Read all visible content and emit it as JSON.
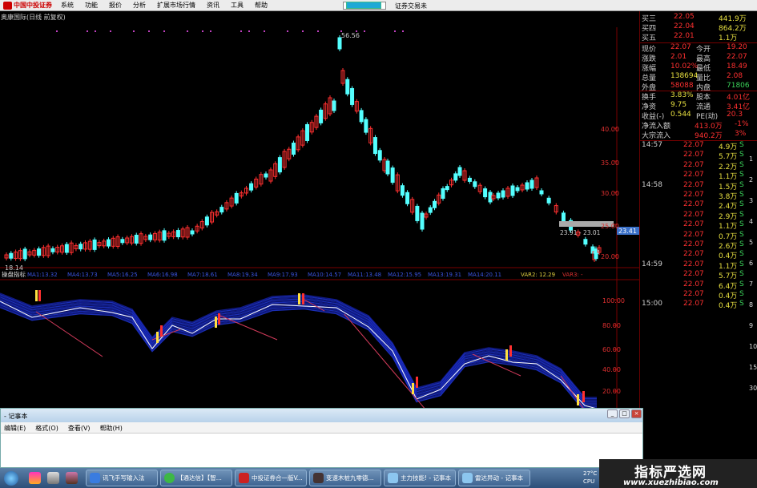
{
  "menubar": {
    "brand": "中国中投证券",
    "items": [
      "系统",
      "功能",
      "报价",
      "分析",
      "扩展市场行情",
      "资讯",
      "工具",
      "帮助"
    ],
    "trade_link": "证券交易未"
  },
  "chart": {
    "title": "奥康国际(日线 前复权)",
    "price_axis": [
      "40.00",
      "35.00",
      "30.00",
      "25.00",
      "20.00"
    ],
    "high_label": "56.56",
    "low_label": "18.14",
    "crosshair_label": "23.41",
    "crosshair_values": "23.91 - 23.01",
    "indicator_name": "操盘指标",
    "indicator_vars": [
      "MA1:13.32",
      "MA4:13.73",
      "MA5:16.25",
      "MA6:16.98",
      "MA7:18.61",
      "MA8:19.34",
      "MA9:17.93",
      "MA10:14.57",
      "MA11:13.48",
      "MA12:15.95",
      "MA13:19.31",
      "MA14:20.11"
    ],
    "var2": "VAR2: 12.29",
    "var3": "VAR3: -",
    "indicator_axis": [
      "100.00",
      "80.00",
      "60.00",
      "40.00",
      "20.00"
    ]
  },
  "quote": {
    "orders": [
      {
        "label": "买三",
        "price": "22.05",
        "vol": "441.9万"
      },
      {
        "label": "买四",
        "price": "22.04",
        "vol": "864.2万"
      },
      {
        "label": "买五",
        "price": "22.01",
        "vol": "1.1万"
      }
    ],
    "stats": [
      {
        "l1": "现价",
        "v1": "22.07",
        "l2": "今开",
        "v2": "19.20"
      },
      {
        "l1": "涨跌",
        "v1": "2.01",
        "l2": "最高",
        "v2": "22.07"
      },
      {
        "l1": "涨幅",
        "v1": "10.02%",
        "l2": "最低",
        "v2": "18.49"
      },
      {
        "l1": "总量",
        "v1": "138694",
        "l2": "量比",
        "v2": "2.08"
      },
      {
        "l1": "外盘",
        "v1": "58088",
        "l2": "内盘",
        "v2": "71806"
      },
      {
        "l1": "换手",
        "v1": "3.83%",
        "l2": "股本",
        "v2": "4.01亿"
      },
      {
        "l1": "净资",
        "v1": "9.75",
        "l2": "流通",
        "v2": "3.41亿"
      },
      {
        "l1": "收益(-)",
        "v1": "0.544",
        "l2": "PE(动)",
        "v2": "20.3"
      }
    ],
    "flows": [
      {
        "label": "净流入额",
        "value": "413.0万",
        "pct": "-1%"
      },
      {
        "label": "大宗流入",
        "value": "940.2万",
        "pct": "3%"
      }
    ],
    "ticks": [
      {
        "time": "14:57",
        "price": "22.07",
        "vol": "4.9万",
        "dir": "S"
      },
      {
        "time": "",
        "price": "22.07",
        "vol": "5.7万",
        "dir": "S"
      },
      {
        "time": "",
        "price": "22.07",
        "vol": "2.2万",
        "dir": "S"
      },
      {
        "time": "",
        "price": "22.07",
        "vol": "1.1万",
        "dir": "S"
      },
      {
        "time": "14:58",
        "price": "22.07",
        "vol": "1.5万",
        "dir": "S"
      },
      {
        "time": "",
        "price": "22.07",
        "vol": "3.8万",
        "dir": "S"
      },
      {
        "time": "",
        "price": "22.07",
        "vol": "2.4万",
        "dir": "S"
      },
      {
        "time": "",
        "price": "22.07",
        "vol": "2.9万",
        "dir": "S"
      },
      {
        "time": "",
        "price": "22.07",
        "vol": "1.1万",
        "dir": "S"
      },
      {
        "time": "",
        "price": "22.07",
        "vol": "0.7万",
        "dir": "S"
      },
      {
        "time": "",
        "price": "22.07",
        "vol": "2.6万",
        "dir": "S"
      },
      {
        "time": "",
        "price": "22.07",
        "vol": "0.4万",
        "dir": "S"
      },
      {
        "time": "14:59",
        "price": "22.07",
        "vol": "1.1万",
        "dir": "S"
      },
      {
        "time": "",
        "price": "22.07",
        "vol": "5.7万",
        "dir": "S"
      },
      {
        "time": "",
        "price": "22.07",
        "vol": "6.4万",
        "dir": "S"
      },
      {
        "time": "",
        "price": "22.07",
        "vol": "0.4万",
        "dir": "S"
      },
      {
        "time": "15:00",
        "price": "22.07",
        "vol": "0.4万",
        "dir": "S"
      }
    ],
    "side_numbers": [
      "1",
      "2",
      "3",
      "4",
      "5",
      "6",
      "7",
      "8",
      "9",
      "10",
      "15",
      "30"
    ]
  },
  "notepad": {
    "title": "- 记事本",
    "menu": [
      "编辑(E)",
      "格式(O)",
      "查看(V)",
      "帮助(H)"
    ]
  },
  "taskbar": {
    "items": [
      "讯飞手写输入法",
      "【通达信】【智...",
      "中投证券合一版V...",
      "变速木桩九零德...",
      "主力技能! - 记事本",
      "雷达异动 - 记事本"
    ],
    "tray": "27°C",
    "tray2": "CPU"
  },
  "watermark": {
    "main": "指标严选网",
    "sub": "www.xuezhibiao.com"
  },
  "colors": {
    "up": "#ff3030",
    "down": "#54ffff",
    "ribbon": "#1f2fd6",
    "menubar": "#ececec"
  }
}
